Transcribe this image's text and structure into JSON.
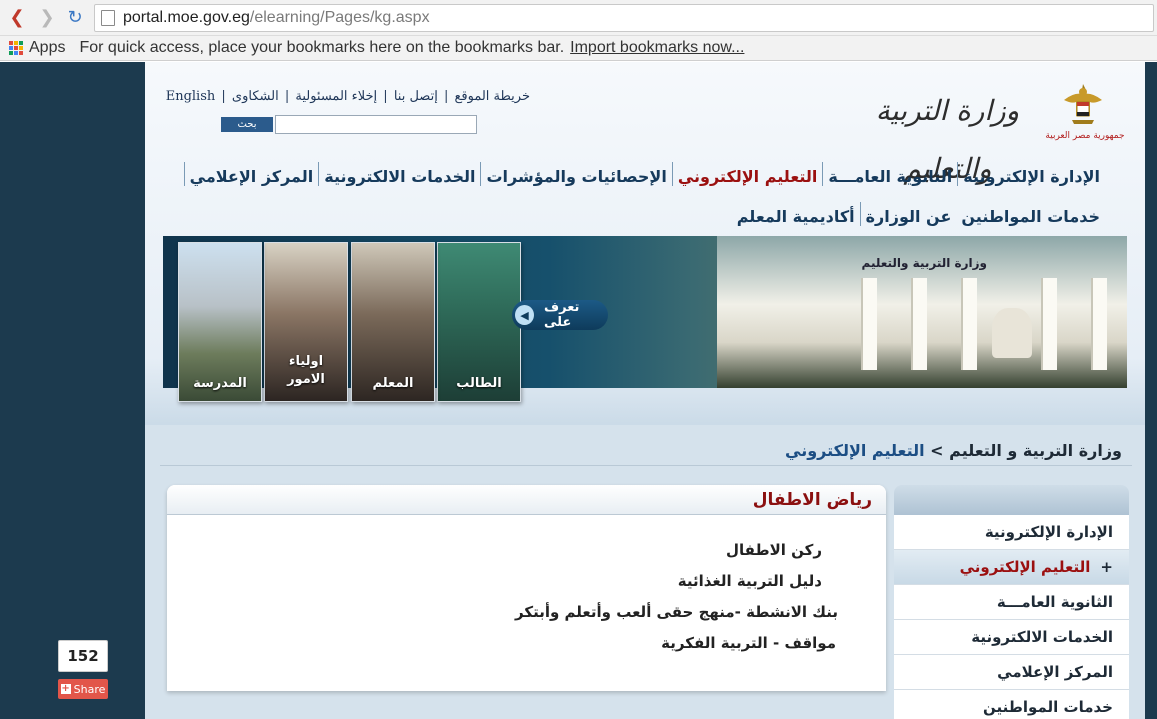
{
  "browser": {
    "url_host": "portal.moe.gov.eg",
    "url_path": "/elearning/Pages/kg.aspx",
    "apps_label": "Apps",
    "bookmarks_message": "For quick access, place your bookmarks here on the bookmarks bar.",
    "import_link": "Import bookmarks now..."
  },
  "header": {
    "top_links": [
      "English",
      "الشكاوى",
      "إخلاء المسئولية",
      "إتصل بنا",
      "خريطة الموقع"
    ],
    "search_button": "بحث",
    "logo_text": "وزارة التربية والتعليم",
    "emblem_caption": "جمهورية مصر العربية"
  },
  "main_nav": [
    "الإدارة الإلكترونية",
    "الثانوية العامـــة",
    "التعليم الإلكتروني",
    "الإحصائيات والمؤشرات",
    "الخدمات الالكترونية",
    "المركز الإعلامي",
    "خدمات المواطنين",
    "عن الوزارة",
    "أكاديمية المعلم"
  ],
  "banner": {
    "know_button": "تعرف على",
    "building_sign": "وزارة التربية والتعليم",
    "cards": [
      "الطالب",
      "المعلم",
      "اولياء الامور",
      "المدرسة"
    ]
  },
  "breadcrumb": {
    "root": "وزارة التربية و التعليم",
    "separator": ">",
    "current": "التعليم الإلكتروني"
  },
  "panel": {
    "title": "رياض الاطفال",
    "links": [
      "ركن الاطفال",
      "دليل التربية الغذائية",
      "بنك الانشطة -منهج حقى ألعب وأتعلم وأبتكر",
      "مواقف - التربية الفكرية"
    ]
  },
  "side_menu": [
    "الإدارة الإلكترونية",
    "التعليم الإلكتروني",
    "الثانوية العامـــة",
    "الخدمات الالكترونية",
    "المركز الإعلامي",
    "خدمات المواطنين"
  ],
  "side_active_plus": "+",
  "share": {
    "count": "152",
    "label": "Share"
  },
  "colors": {
    "nav_text": "#163a5c",
    "active_red": "#9b1010",
    "share_red": "#e2564a",
    "page_backdrop": "#1c3a4e"
  }
}
